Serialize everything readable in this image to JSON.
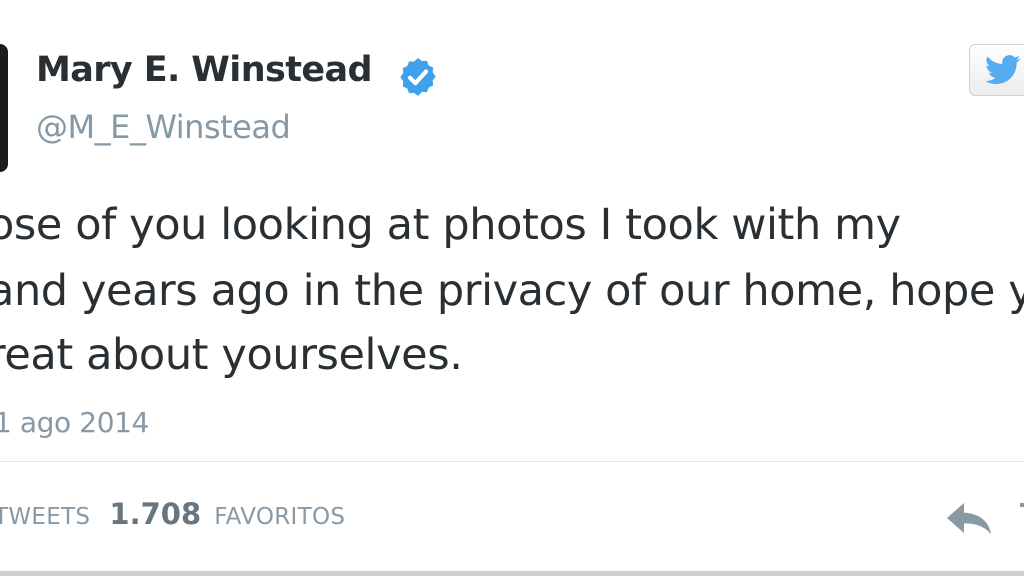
{
  "author": {
    "name": "Mary E. Winstead",
    "handle": "@M_E_Winstead",
    "verified_icon": "verified-badge-icon",
    "verified_color": "#3ea1ec"
  },
  "follow_button": {
    "icon": "twitter-bird-icon",
    "icon_color": "#55acee"
  },
  "tweet": {
    "lines": [
      "ose of you looking at photos I took with my",
      "and years ago in the privacy of our home, hope y",
      "reat about yourselves."
    ],
    "timestamp": "1 ago 2014"
  },
  "stats": {
    "retweets_label": "TWEETS",
    "favorites_count": "1.708",
    "favorites_label": "FAVORITOS"
  },
  "actions": {
    "reply_icon": "reply-arrow-icon",
    "retweet_icon": "retweet-icon"
  }
}
